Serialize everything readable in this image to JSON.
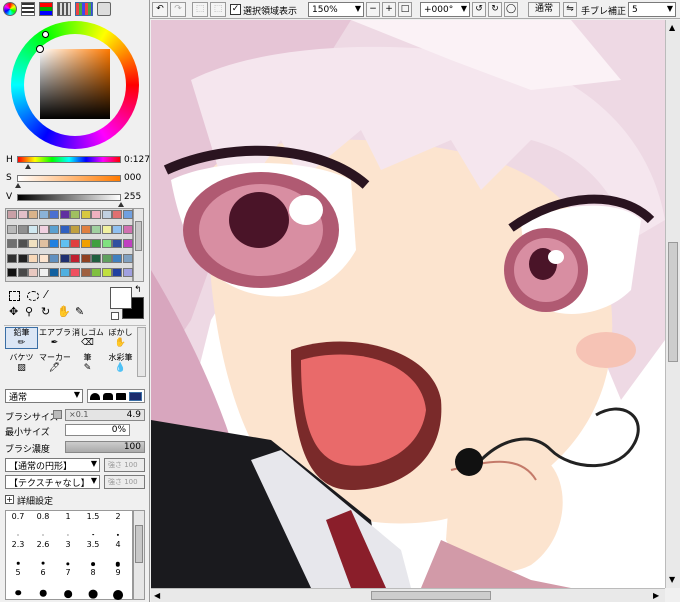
{
  "tabs": [
    "",
    "",
    "",
    "",
    ""
  ],
  "toolbar": {
    "show_selection_checked": true,
    "show_selection_label": "選択領域表示",
    "zoom_value": "150%",
    "rotate_value": "+000°",
    "blend_mode": "通常",
    "stabilizer_label": "手ブレ補正",
    "stabilizer_value": "5"
  },
  "color_panel": {
    "h_label": "H",
    "h_value": "0:127",
    "s_label": "S",
    "s_value": "000",
    "v_label": "V",
    "v_value": "255",
    "h_fraction": 0.12,
    "s_fraction": 0.0,
    "v_fraction": 1.0
  },
  "tools_row1": [
    "",
    "",
    "",
    "",
    "",
    ""
  ],
  "brushes": [
    {
      "label": "鉛筆",
      "selected": true
    },
    {
      "label": "エアブラシ",
      "selected": false
    },
    {
      "label": "消しゴム",
      "selected": false
    },
    {
      "label": "ぼかし",
      "selected": false
    },
    {
      "label": "バケツ",
      "selected": false
    },
    {
      "label": "マーカー",
      "selected": false
    },
    {
      "label": "筆",
      "selected": false
    },
    {
      "label": "水彩筆",
      "selected": false
    }
  ],
  "brush_settings": {
    "mode": "通常",
    "size_label": "ブラシサイズ",
    "size_multiplier": "×0.1",
    "size_value": "4.9",
    "min_size_label": "最小サイズ",
    "min_size_value": "0%",
    "density_label": "ブラシ濃度",
    "density_value": "100",
    "shape_select": "【通常の円形】",
    "shape_strength": "強さ 100",
    "texture_select": "【テクスチャなし】",
    "texture_strength": "強さ 100",
    "advanced_label": "詳細設定"
  },
  "brush_sizes": [
    [
      "0.7",
      "0.8",
      "1",
      "1.5",
      "2"
    ],
    [
      "2.3",
      "2.6",
      "3",
      "3.5",
      "4"
    ],
    [
      "5",
      "6",
      "7",
      "8",
      "9"
    ]
  ],
  "colors": {
    "accent": "#3a6ea5",
    "canvas_bg": "#ffffff"
  }
}
